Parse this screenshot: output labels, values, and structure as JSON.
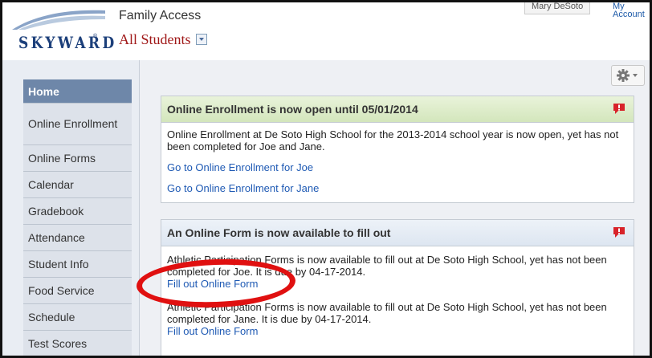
{
  "header": {
    "logo_text": "SKYWARD",
    "app_title": "Family Access",
    "student_selector": "All Students",
    "user_name": "Mary DeSoto",
    "my_account": "My Account"
  },
  "sidebar": {
    "items": [
      {
        "label": "Home"
      },
      {
        "label": "Online Enrollment"
      },
      {
        "label": "Online Forms"
      },
      {
        "label": "Calendar"
      },
      {
        "label": "Gradebook"
      },
      {
        "label": "Attendance"
      },
      {
        "label": "Student Info"
      },
      {
        "label": "Food Service"
      },
      {
        "label": "Schedule"
      },
      {
        "label": "Test Scores"
      }
    ]
  },
  "enrollment_panel": {
    "title": "Online Enrollment is now open until 05/01/2014",
    "message": "Online Enrollment at De Soto High School for the 2013-2014 school year is now open, yet has not been completed for Joe and Jane.",
    "link_joe": "Go to Online Enrollment for Joe",
    "link_jane": "Go to Online Enrollment for Jane"
  },
  "forms_panel": {
    "title": "An Online Form is now available to fill out",
    "message_joe": "Athletic Participation Forms is now available to fill out at De Soto High School, yet has not been completed for Joe.  It is due by 04-17-2014.",
    "link_joe": "Fill out Online Form",
    "message_jane": "Athletic Participation Forms is now available to fill out at De Soto High School, yet has not been completed for Jane.  It is due by 04-17-2014.",
    "link_jane": "Fill out Online Form"
  },
  "colors": {
    "accent_link": "#1f5ab4",
    "alert_red": "#d8232a",
    "annotation_red": "#e01010",
    "nav_active": "#6e87a9"
  },
  "icons": {
    "settings": "gear-icon",
    "alert": "alert-icon",
    "dropdown": "chevron-down-icon"
  }
}
